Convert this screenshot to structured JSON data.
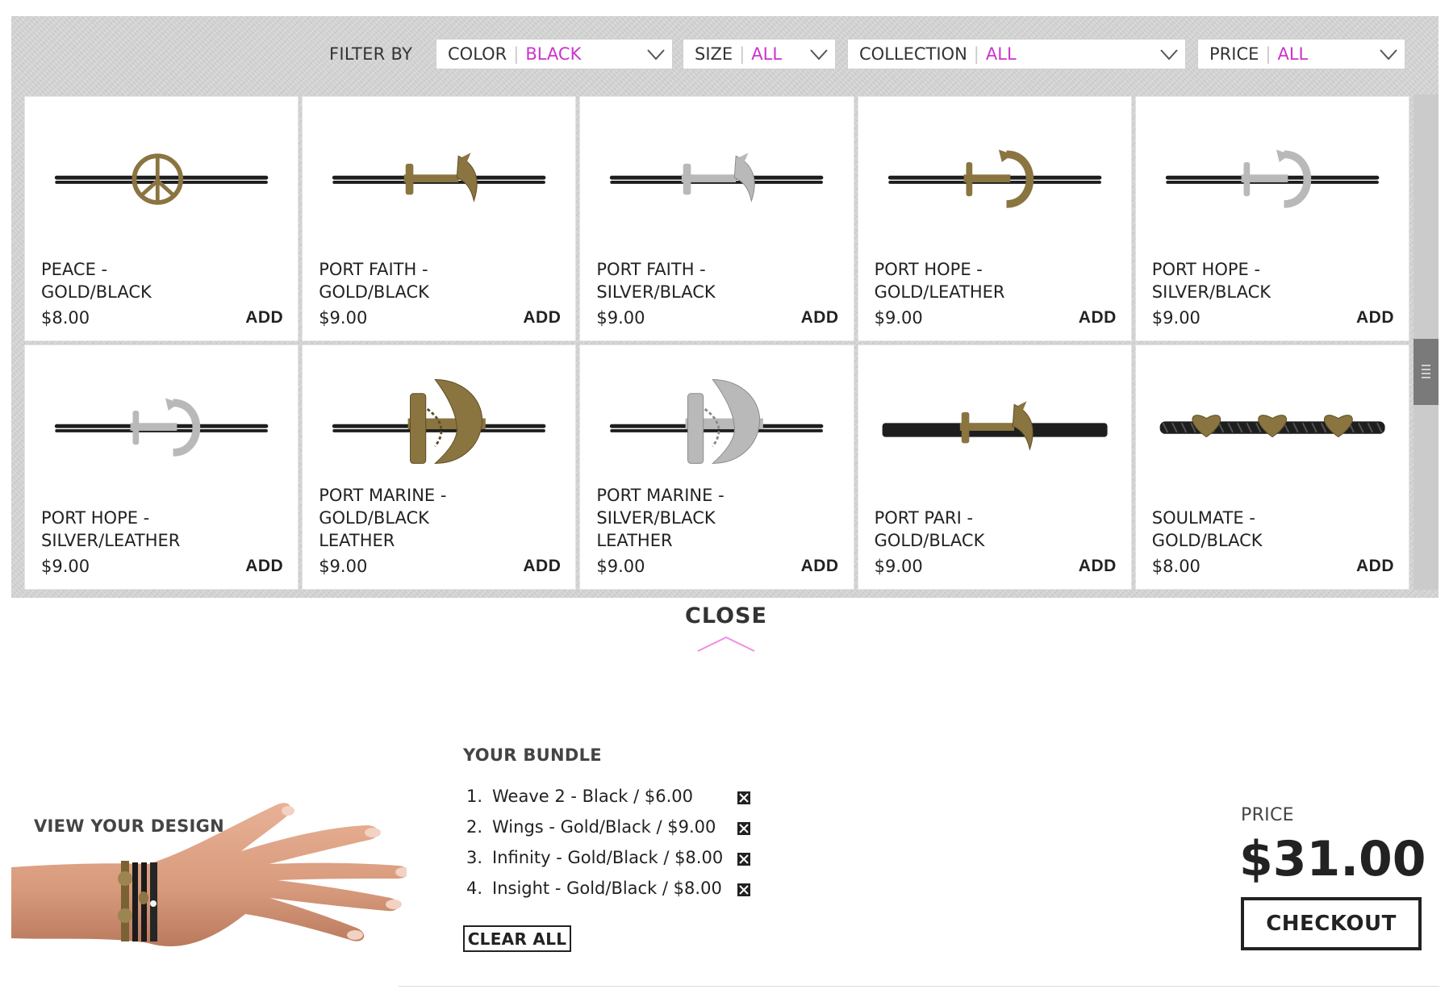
{
  "filters": {
    "label": "FILTER BY",
    "items": [
      {
        "name": "COLOR",
        "value": "BLACK"
      },
      {
        "name": "SIZE",
        "value": "ALL"
      },
      {
        "name": "COLLECTION",
        "value": "ALL"
      },
      {
        "name": "PRICE",
        "value": "ALL"
      }
    ]
  },
  "products": [
    {
      "name": "PEACE -\nGOLD/BLACK",
      "price": "$8.00",
      "add": "ADD",
      "charm": "peace",
      "metal": "gold",
      "band": "cord"
    },
    {
      "name": "PORT FAITH -\nGOLD/BLACK",
      "price": "$9.00",
      "add": "ADD",
      "charm": "anchor",
      "metal": "gold",
      "band": "cord"
    },
    {
      "name": "PORT FAITH -\nSILVER/BLACK",
      "price": "$9.00",
      "add": "ADD",
      "charm": "anchor",
      "metal": "silver",
      "band": "cord"
    },
    {
      "name": "PORT HOPE -\nGOLD/LEATHER",
      "price": "$9.00",
      "add": "ADD",
      "charm": "hook",
      "metal": "gold",
      "band": "cord"
    },
    {
      "name": "PORT HOPE -\nSILVER/BLACK",
      "price": "$9.00",
      "add": "ADD",
      "charm": "hook",
      "metal": "silver",
      "band": "cord"
    },
    {
      "name": "PORT HOPE -\nSILVER/LEATHER",
      "price": "$9.00",
      "add": "ADD",
      "charm": "hook",
      "metal": "silver",
      "band": "cord"
    },
    {
      "name": "PORT MARINE -\nGOLD/BLACK\nLEATHER",
      "price": "$9.00",
      "add": "ADD",
      "charm": "big-anchor",
      "metal": "gold",
      "band": "cord"
    },
    {
      "name": "PORT MARINE -\nSILVER/BLACK\nLEATHER",
      "price": "$9.00",
      "add": "ADD",
      "charm": "big-anchor",
      "metal": "silver",
      "band": "cord"
    },
    {
      "name": "PORT PARI -\nGOLD/BLACK",
      "price": "$9.00",
      "add": "ADD",
      "charm": "small-anchor",
      "metal": "gold",
      "band": "flat"
    },
    {
      "name": "SOULMATE -\nGOLD/BLACK",
      "price": "$8.00",
      "add": "ADD",
      "charm": "hearts",
      "metal": "gold",
      "band": "braid"
    }
  ],
  "close_label": "CLOSE",
  "view_design_label": "VIEW YOUR DESIGN",
  "bundle": {
    "title": "YOUR BUNDLE",
    "items": [
      {
        "num": "1.",
        "text": "Weave 2 - Black / $6.00"
      },
      {
        "num": "2.",
        "text": "Wings - Gold/Black / $9.00"
      },
      {
        "num": "3.",
        "text": "Infinity - Gold/Black / $8.00"
      },
      {
        "num": "4.",
        "text": "Insight - Gold/Black / $8.00"
      }
    ],
    "clear_label": "CLEAR ALL"
  },
  "price": {
    "label": "PRICE",
    "value": "$31.00"
  },
  "checkout_label": "CHECKOUT",
  "colors": {
    "accent": "#cc33cc",
    "gold": "#8a7440",
    "silver": "#b9b9b9",
    "cord": "#1e1e1e",
    "close_chevron": "#f08ee0"
  }
}
